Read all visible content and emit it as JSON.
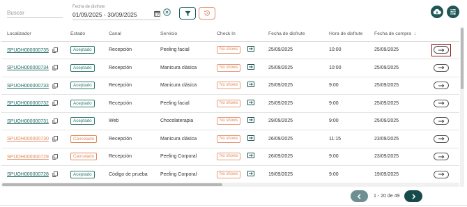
{
  "toolbar": {
    "search_placeholder": "Buscar",
    "date_label": "Fecha de disfrute",
    "date_value": "01/09/2025 - 30/09/2025"
  },
  "table": {
    "headers": {
      "localizador": "Localizador",
      "estado": "Estado",
      "canal": "Canal",
      "servicio": "Servicio",
      "checkin": "Check In",
      "fecha_disfrute": "Fecha de disfrute",
      "hora_disfrute": "Hora de disfrute",
      "fecha_compra": "Fecha de compra"
    },
    "sort_indicator": "↓",
    "rows": [
      {
        "loc": "SPUOH000000735",
        "estado": "Aceptado",
        "canal": "Recepción",
        "servicio": "Peeling facial",
        "checkin": "No shows",
        "fecha": "25/09/2025",
        "hora": "10:00",
        "compra": "25/09/2025"
      },
      {
        "loc": "SPUOH000000734",
        "estado": "Aceptado",
        "canal": "Recepción",
        "servicio": "Manicura clásica",
        "checkin": "No shows",
        "fecha": "25/09/2025",
        "hora": "10:00",
        "compra": "25/09/2025"
      },
      {
        "loc": "SPUOH000000733",
        "estado": "Aceptado",
        "canal": "Recepción",
        "servicio": "Manicura clásica",
        "checkin": "No shows",
        "fecha": "25/09/2025",
        "hora": "9:00",
        "compra": "25/09/2025"
      },
      {
        "loc": "SPUOH000000732",
        "estado": "Aceptado",
        "canal": "Recepción",
        "servicio": "Peeling facial",
        "checkin": "No shows",
        "fecha": "25/09/2025",
        "hora": "9:00",
        "compra": "25/09/2025"
      },
      {
        "loc": "SPUOH000000731",
        "estado": "Aceptado",
        "canal": "Web",
        "servicio": "Chocolaterapia",
        "checkin": "No shows",
        "fecha": "29/09/2025",
        "hora": "9:00",
        "compra": "25/09/2025"
      },
      {
        "loc": "SPUOH000000730",
        "estado": "Cancelado",
        "canal": "Recepción",
        "servicio": "Manicura clásica",
        "checkin": "No shows",
        "fecha": "26/09/2025",
        "hora": "11:15",
        "compra": "23/09/2025"
      },
      {
        "loc": "SPUOH000000729",
        "estado": "Cancelado",
        "canal": "Recepción",
        "servicio": "Peeling Corporal",
        "checkin": "No shows",
        "fecha": "26/09/2025",
        "hora": "9:00",
        "compra": "23/09/2025"
      },
      {
        "loc": "SPUOH000000728",
        "estado": "Aceptado",
        "canal": "Código de prueba",
        "servicio": "Peeling Corporal",
        "checkin": "No shows",
        "fecha": "19/09/2025",
        "hora": "9:00",
        "compra": "19/09/2025"
      }
    ]
  },
  "pagination": {
    "label": "1 - 20 de 49"
  },
  "colors": {
    "accent": "#1f5656",
    "accepted": "#2f7a6d",
    "cancelled": "#e08a5a",
    "highlight": "#8b1a1a"
  }
}
